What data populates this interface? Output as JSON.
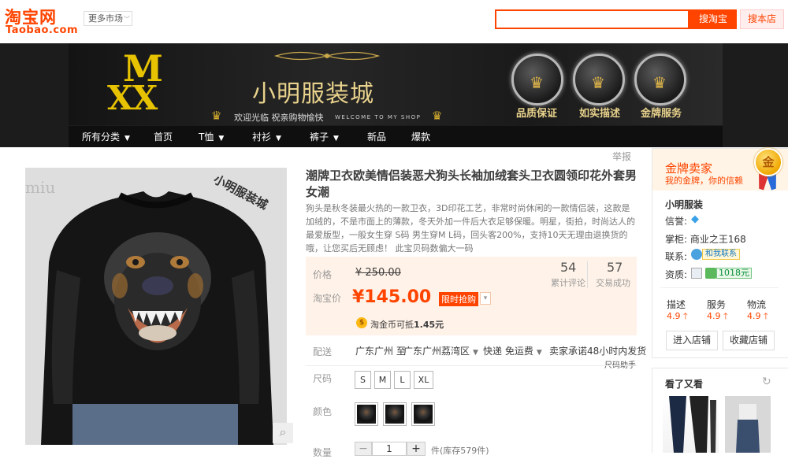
{
  "header": {
    "logo_cn": "淘宝网",
    "logo_en": "Taobao.com",
    "market_label": "更多市场",
    "search_button": "搜淘宝",
    "store_button": "搜本店"
  },
  "banner": {
    "logo_m": "M",
    "logo_xx": "XX",
    "shop_title": "小明服装城",
    "welcome_cn": "欢迎光临  祝亲购物愉快",
    "welcome_en": "WELCOME TO MY SHOP",
    "badges": [
      "品质保证",
      "如实描述",
      "金牌服务"
    ],
    "nav": [
      {
        "label": "所有分类",
        "dropdown": true
      },
      {
        "label": "首页",
        "dropdown": false
      },
      {
        "label": "T恤",
        "dropdown": true
      },
      {
        "label": "衬衫",
        "dropdown": true
      },
      {
        "label": "裤子",
        "dropdown": true
      },
      {
        "label": "新品",
        "dropdown": false
      },
      {
        "label": "爆款",
        "dropdown": false
      }
    ]
  },
  "product": {
    "watermark": "小明服装城",
    "watermark_left": "miu",
    "report": "举报",
    "title": "潮牌卫衣欧美情侣装恶犬狗头长袖加绒套头卫衣圆领印花外套男女潮",
    "description": "狗头是秋冬装最火热的一款卫衣，3D印花工艺，非常时尚休闲的一款情侣装，这款是加绒的，不是市面上的薄款，冬天外加一件后大衣足够保暖。明星，街拍，时尚达人的最爱版型，一般女生穿 S码 男生穿M L码，回头客200%，支持10天无理由退换货的哦，让您买后无顾虑！ 此宝贝码数偏大一码",
    "price_label": "价格",
    "price_original": "¥ 250.00",
    "taobao_price_label": "淘宝价",
    "taobao_price": "¥145.00",
    "promo_tag": "限时抢购",
    "review_count": "54",
    "review_label": "累计评论",
    "sales_count": "57",
    "sales_label": "交易成功",
    "coin_text_prefix": "淘金币可抵",
    "coin_value": "1.45元",
    "shipping_label": "配送",
    "ship_from": "广东广州 至",
    "ship_to": "广东广州荔湾区",
    "ship_fee": "快递 免运费",
    "ship_promise": "卖家承诺48小时内发货",
    "size_helper": "尺码助手",
    "size_label": "尺码",
    "sizes": [
      "S",
      "M",
      "L",
      "XL"
    ],
    "color_label": "颜色",
    "quantity_label": "数量",
    "quantity_value": "1",
    "stock_text": "件(库存579件)",
    "colors": {
      "accent": "#ff4400",
      "price_bg": "#fff2e8"
    }
  },
  "seller": {
    "level_label": "金牌卖家",
    "level_sub": "我的金牌，你的信赖",
    "medal_text": "金",
    "name": "小明服装",
    "reputation_label": "信誉:",
    "owner_label": "掌柜:",
    "owner_value": "商业之王168",
    "contact_label": "联系:",
    "contact_button": "和我联系",
    "cert_label": "资质:",
    "cert_number": "1018元",
    "scores": [
      {
        "label": "描述",
        "value": "4.9"
      },
      {
        "label": "服务",
        "value": "4.9"
      },
      {
        "label": "物流",
        "value": "4.9"
      }
    ],
    "enter_store": "进入店铺",
    "favorite_store": "收藏店铺",
    "also_viewed_title": "看了又看"
  }
}
